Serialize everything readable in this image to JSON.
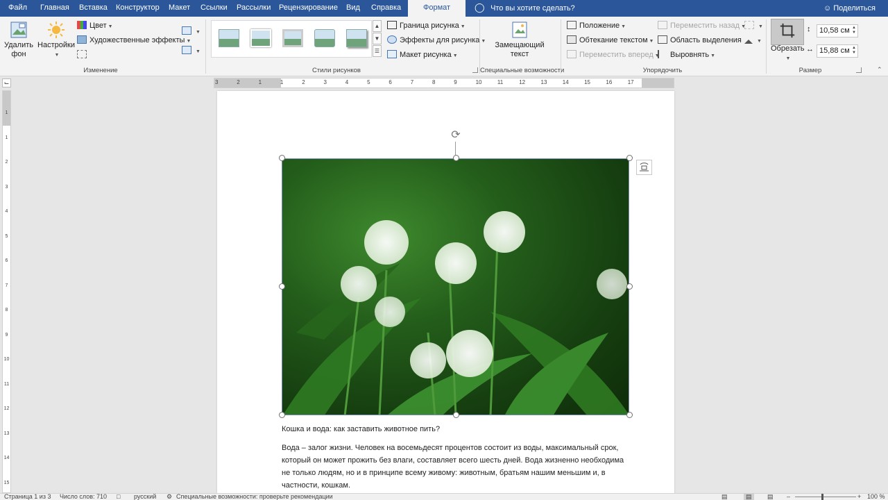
{
  "tabs": [
    "Файл",
    "Главная",
    "Вставка",
    "Конструктор",
    "Макет",
    "Ссылки",
    "Рассылки",
    "Рецензирование",
    "Вид",
    "Справка",
    "Формат"
  ],
  "tell_me": "Что вы хотите сделать?",
  "share": "Поделиться",
  "ribbon": {
    "adjust": {
      "remove_bg_line1": "Удалить",
      "remove_bg_line2": "фон",
      "corrections": "Настройки",
      "color": "Цвет",
      "artistic": "Художественные эффекты",
      "label": "Изменение"
    },
    "styles": {
      "border": "Граница рисунка",
      "effects": "Эффекты для рисунка",
      "layout": "Макет рисунка",
      "label": "Стили рисунков"
    },
    "accessibility": {
      "alt_line1": "Замещающий",
      "alt_line2": "текст",
      "label": "Специальные возможности"
    },
    "arrange": {
      "position": "Положение",
      "wrap": "Обтекание текстом",
      "forward": "Переместить вперед",
      "backward": "Переместить назад",
      "selection_pane": "Область выделения",
      "align": "Выровнять",
      "label": "Упорядочить"
    },
    "size": {
      "crop": "Обрезать",
      "height": "10,58 см",
      "width": "15,88 см",
      "label": "Размер"
    }
  },
  "ruler_h": [
    "3",
    "2",
    "1",
    "1",
    "2",
    "3",
    "4",
    "5",
    "6",
    "7",
    "8",
    "9",
    "10",
    "11",
    "12",
    "13",
    "14",
    "15",
    "16",
    "17"
  ],
  "ruler_v": [
    "1",
    "1",
    "2",
    "3",
    "4",
    "5",
    "6",
    "7",
    "8",
    "9",
    "10",
    "11",
    "12",
    "13",
    "14",
    "15"
  ],
  "document": {
    "heading": "Кошка и вода: как заставить животное пить?",
    "lines": [
      "Вода – залог жизни. Человек на восемьдесят процентов состоит из воды, максимальный срок,",
      "который он может прожить без влаги, составляет всего шесть дней. Вода жизненно необходима",
      "не только людям, но и в принципе всему живому: животным, братьям нашим меньшим и, в",
      "частности, кошкам."
    ]
  },
  "status": {
    "page": "Страница 1 из 3",
    "words": "Число слов: 710",
    "language": "русский",
    "accessibility": "Специальные возможности: проверьте рекомендации",
    "zoom": "100 %"
  },
  "colors": {
    "brand": "#2b579a",
    "ribbon_bg": "#f3f3f3"
  }
}
